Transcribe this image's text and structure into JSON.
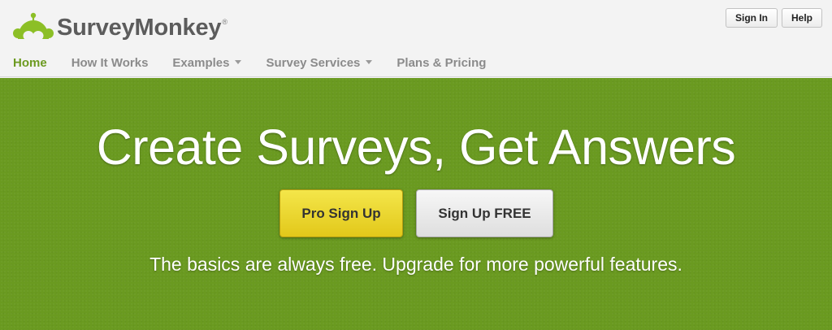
{
  "brand": {
    "name": "SurveyMonkey",
    "registered": "®",
    "logo_icon": "monkey-face-icon",
    "color": "#8cbf26"
  },
  "header": {
    "sign_in": "Sign In",
    "help": "Help"
  },
  "nav": {
    "items": [
      {
        "label": "Home",
        "active": true,
        "dropdown": false
      },
      {
        "label": "How It Works",
        "active": false,
        "dropdown": false
      },
      {
        "label": "Examples",
        "active": false,
        "dropdown": true
      },
      {
        "label": "Survey Services",
        "active": false,
        "dropdown": true
      },
      {
        "label": "Plans & Pricing",
        "active": false,
        "dropdown": false
      }
    ]
  },
  "hero": {
    "headline": "Create Surveys, Get Answers",
    "pro_button": "Pro Sign Up",
    "free_button": "Sign Up FREE",
    "tagline": "The basics are always free. Upgrade for more powerful features.",
    "background_color": "#6a9a20",
    "pro_button_color": "#f0dc30"
  }
}
